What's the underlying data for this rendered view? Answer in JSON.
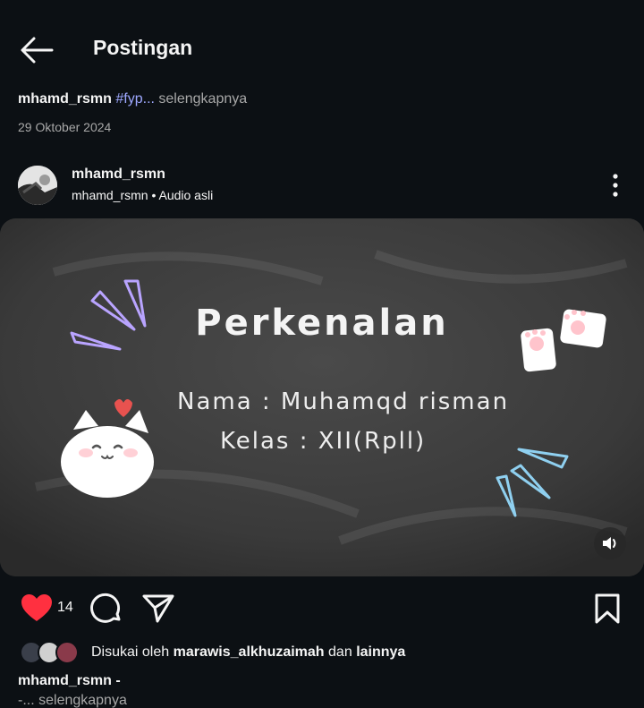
{
  "header": {
    "title": "Postingan"
  },
  "caption_top": {
    "username": "mhamd_rsmn",
    "hashtag": "#fyp...",
    "more": "selengkapnya"
  },
  "post_date": "29 Oktober 2024",
  "author": {
    "username": "mhamd_rsmn",
    "subtitle": "mhamd_rsmn • Audio asli"
  },
  "video": {
    "title": "Perkenalan",
    "line1": "Nama : Muhamqd risman",
    "line2": "Kelas : XII(Rpll)"
  },
  "actions": {
    "like_count": "14"
  },
  "liked_by": {
    "prefix": "Disukai oleh",
    "user": "marawis_alkhuzaimah",
    "joiner": "dan",
    "others": "lainnya"
  },
  "caption_bottom": {
    "text": "mhamd_rsmn -",
    "more": "-... selengkapnya"
  },
  "colors": {
    "background": "#0c1014",
    "like": "#ff3040",
    "hashtag": "#9ea8ff",
    "muted": "#a8a8a8"
  }
}
